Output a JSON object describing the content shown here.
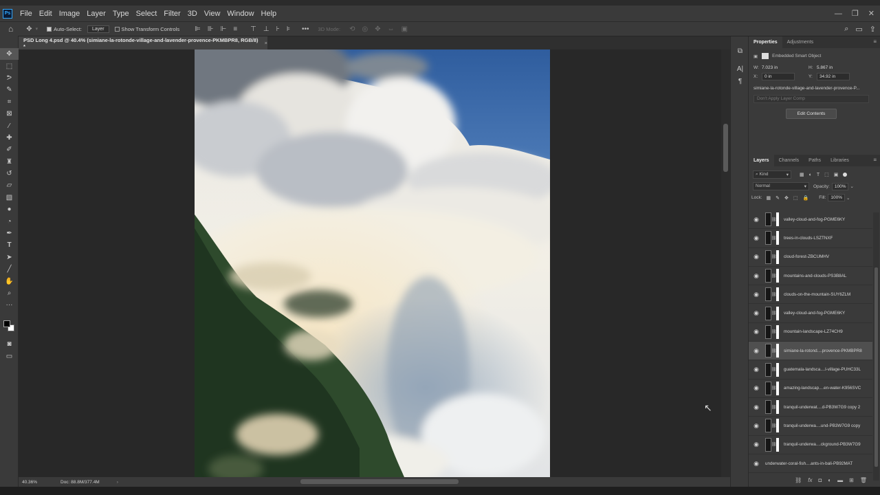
{
  "menubar": {
    "app_icon": "Ps",
    "items": [
      "File",
      "Edit",
      "Image",
      "Layer",
      "Type",
      "Select",
      "Filter",
      "3D",
      "View",
      "Window",
      "Help"
    ]
  },
  "options": {
    "auto_select_label": "Auto-Select:",
    "auto_select_target": "Layer",
    "show_transform_label": "Show Transform Controls",
    "mode_3d_label": "3D Mode:"
  },
  "document": {
    "tab_title": "PSD Long 4.psd @ 40.4% (simiane-la-rotonde-village-and-lavender-provence-PKMBPR8, RGB/8) *",
    "tab_close": "×"
  },
  "status": {
    "zoom": "40.36%",
    "doc_size": "Doc: 88.8M/377.4M"
  },
  "properties": {
    "tabs": [
      "Properties",
      "Adjustments"
    ],
    "object_type": "Embedded Smart Object",
    "w_label": "W:",
    "w_value": "7.023 in",
    "h_label": "H:",
    "h_value": "5.867 in",
    "x_label": "X:",
    "x_value": "0 in",
    "y_label": "Y:",
    "y_value": "34.92 in",
    "file_name": "simiane-la-rotonde-village-and-lavender-provence-P...",
    "layer_comp_placeholder": "Don't Apply Layer Comp",
    "edit_contents_label": "Edit Contents"
  },
  "layers_panel": {
    "tabs": [
      "Layers",
      "Channels",
      "Paths",
      "Libraries"
    ],
    "filter_kind": "Kind",
    "blend_mode": "Normal",
    "opacity_label": "Opacity:",
    "opacity_value": "100%",
    "lock_label": "Lock:",
    "fill_label": "Fill:",
    "fill_value": "100%",
    "selected_index": 7,
    "layers": [
      "valley-cloud-and-fog-PGME6KY",
      "trees-in-clouds-LSZTNXF",
      "cloud-forest-ZBCUMHV",
      "mountains-and-clouds-PS3B8AL",
      "clouds-on-the-mountain-SUY6ZLM",
      "valley-cloud-and-fog-PGME6KY",
      "mountain-landscape-LZ74CH9",
      "simiane-la-rotond....provence-PKMBPR8",
      "guatemala-landsca....l-village-PUHC33L",
      "amazing-landscap....en-water-K956SVC",
      "tranquil-underwat....d-PB3W7G9 copy 2",
      "tranquil-underwa....und-PB3W7G9 copy",
      "tranquil-underwa....ckground-PB3W7G9",
      "underwater-coral-fish....ants-in-bali-PB92MAT"
    ]
  },
  "colors": {
    "ui_dark": "#262626",
    "ui_panel": "#3a3a3a",
    "accent": "#31a8ff",
    "sky": "#3f6aa8"
  },
  "icons": {
    "tools": [
      "move-icon",
      "marquee-icon",
      "lasso-icon",
      "quick-select-icon",
      "crop-icon",
      "frame-icon",
      "eyedropper-icon",
      "healing-icon",
      "brush-icon",
      "stamp-icon",
      "history-brush-icon",
      "eraser-icon",
      "gradient-icon",
      "blur-icon",
      "dodge-icon",
      "pen-icon",
      "type-icon",
      "path-select-icon",
      "line-icon",
      "hand-icon",
      "zoom-icon",
      "more-icon"
    ]
  }
}
